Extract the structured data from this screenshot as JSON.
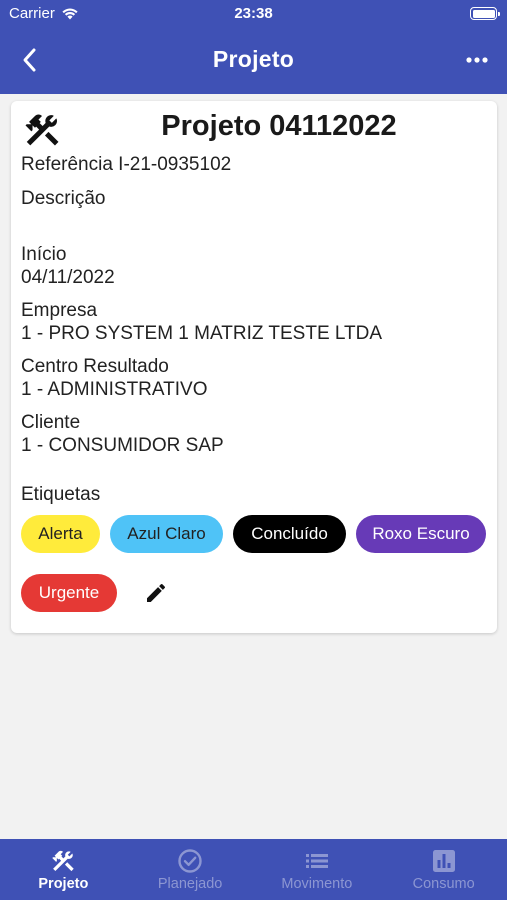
{
  "status_bar": {
    "carrier": "Carrier",
    "time": "23:38"
  },
  "nav": {
    "title": "Projeto",
    "back_icon": "chevron-left-icon",
    "more_icon": "more-horizontal-icon"
  },
  "project": {
    "icon": "tools-icon",
    "title": "Projeto 04112022",
    "reference": "Referência I-21-0935102",
    "description_label": "Descrição",
    "start_label": "Início",
    "start_value": "04/11/2022",
    "company_label": "Empresa",
    "company_value": "1 - PRO SYSTEM 1 MATRIZ TESTE LTDA",
    "cost_center_label": "Centro Resultado",
    "cost_center_value": "1 - ADMINISTRATIVO",
    "client_label": "Cliente",
    "client_value": "1 - CONSUMIDOR SAP",
    "tags_label": "Etiquetas",
    "tags": [
      {
        "label": "Alerta",
        "bg": "#ffeb3b",
        "fg": "#222222"
      },
      {
        "label": "Azul Claro",
        "bg": "#4fc3f7",
        "fg": "#222222"
      },
      {
        "label": "Concluído",
        "bg": "#000000",
        "fg": "#ffffff"
      },
      {
        "label": "Roxo Escuro",
        "bg": "#673ab7",
        "fg": "#ffffff"
      },
      {
        "label": "Urgente",
        "bg": "#e53935",
        "fg": "#ffffff"
      }
    ],
    "edit_icon": "pencil-icon"
  },
  "tabbar": {
    "items": [
      {
        "label": "Projeto",
        "icon": "tools-icon",
        "active": true
      },
      {
        "label": "Planejado",
        "icon": "check-circle-icon",
        "active": false
      },
      {
        "label": "Movimento",
        "icon": "list-icon",
        "active": false
      },
      {
        "label": "Consumo",
        "icon": "bar-chart-icon",
        "active": false
      }
    ]
  },
  "colors": {
    "primary": "#3f51b5",
    "background": "#f2f2f2",
    "tab_inactive": "#8c96d2"
  }
}
